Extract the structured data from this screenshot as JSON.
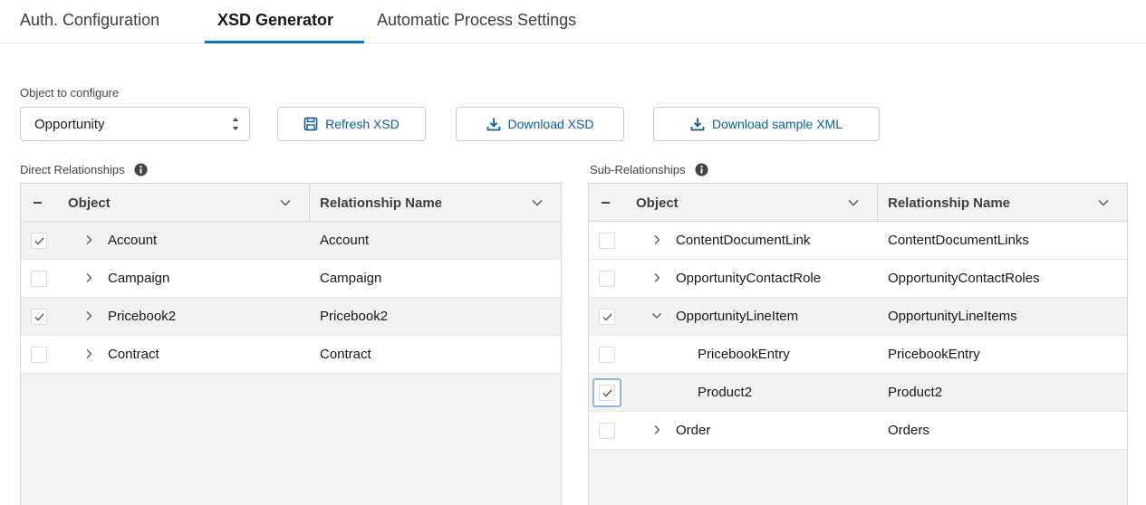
{
  "tabs": [
    {
      "label": "Auth. Configuration",
      "active": false
    },
    {
      "label": "XSD Generator",
      "active": true
    },
    {
      "label": "Automatic Process Settings",
      "active": false
    }
  ],
  "config": {
    "label": "Object to configure",
    "selected_object": "Opportunity"
  },
  "buttons": {
    "refresh": "Refresh XSD",
    "download_xsd": "Download XSD",
    "download_sample": "Download sample XML"
  },
  "direct": {
    "title": "Direct Relationships",
    "columns": [
      "Object",
      "Relationship Name"
    ],
    "rows": [
      {
        "object": "Account",
        "relationship": "Account",
        "checked": true,
        "expandable": true
      },
      {
        "object": "Campaign",
        "relationship": "Campaign",
        "checked": false,
        "expandable": true
      },
      {
        "object": "Pricebook2",
        "relationship": "Pricebook2",
        "checked": true,
        "expandable": true
      },
      {
        "object": "Contract",
        "relationship": "Contract",
        "checked": false,
        "expandable": true
      }
    ]
  },
  "sub": {
    "title": "Sub-Relationships",
    "columns": [
      "Object",
      "Relationship Name"
    ],
    "rows": [
      {
        "object": "ContentDocumentLink",
        "relationship": "ContentDocumentLinks",
        "checked": false,
        "expandable": true,
        "expanded": false,
        "level": 1
      },
      {
        "object": "OpportunityContactRole",
        "relationship": "OpportunityContactRoles",
        "checked": false,
        "expandable": true,
        "expanded": false,
        "level": 1
      },
      {
        "object": "OpportunityLineItem",
        "relationship": "OpportunityLineItems",
        "checked": true,
        "expandable": true,
        "expanded": true,
        "level": 1
      },
      {
        "object": "PricebookEntry",
        "relationship": "PricebookEntry",
        "checked": false,
        "expandable": false,
        "level": 2
      },
      {
        "object": "Product2",
        "relationship": "Product2",
        "checked": true,
        "expandable": false,
        "level": 2
      },
      {
        "object": "Order",
        "relationship": "Orders",
        "checked": false,
        "expandable": true,
        "expanded": false,
        "level": 1
      }
    ]
  },
  "colors": {
    "accent": "#0176d3",
    "link": "#0b5cab"
  }
}
